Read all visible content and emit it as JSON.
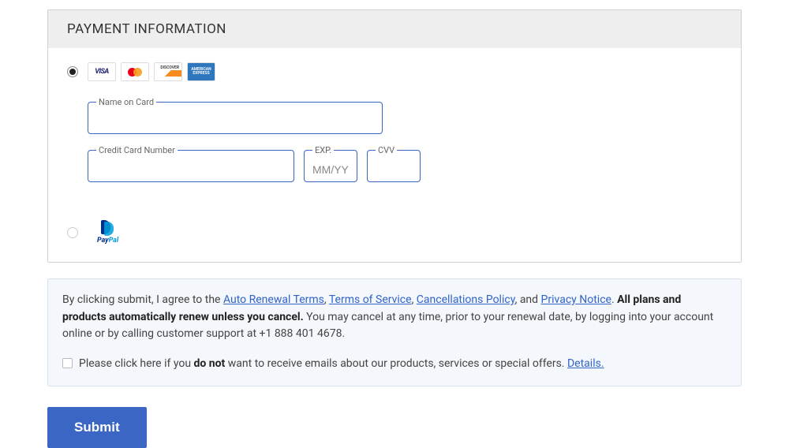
{
  "panel": {
    "title": "PAYMENT INFORMATION"
  },
  "card_option": {
    "selected": true,
    "logos": [
      "visa",
      "mastercard",
      "discover",
      "amex"
    ]
  },
  "fields": {
    "name_on_card": {
      "label": "Name on Card",
      "value": ""
    },
    "card_number": {
      "label": "Credit Card Number",
      "value": ""
    },
    "exp": {
      "label": "EXP.",
      "placeholder": "MM/YY",
      "value": ""
    },
    "cvv": {
      "label": "CVV",
      "value": ""
    }
  },
  "paypal_option": {
    "selected": false,
    "label": "PayPal"
  },
  "terms": {
    "prefix": "By clicking submit, I agree to the ",
    "links": {
      "auto_renewal": "Auto Renewal Terms",
      "tos": "Terms of Service",
      "cancel": "Cancellations Policy",
      "privacy": "Privacy Notice"
    },
    "sep_comma": ", ",
    "sep_and": ", and ",
    "period": ". ",
    "bold": "All plans and products automatically renew unless you cancel.",
    "rest": " You may cancel at any time, prior to your renewal date, by logging into your account online or by calling customer support at +1 888 401 4678."
  },
  "optout": {
    "checked": false,
    "text_pre": "Please click here if you ",
    "text_bold": "do not",
    "text_post": " want to receive emails about our products, services or special offers. ",
    "details": "Details."
  },
  "submit_label": "Submit"
}
